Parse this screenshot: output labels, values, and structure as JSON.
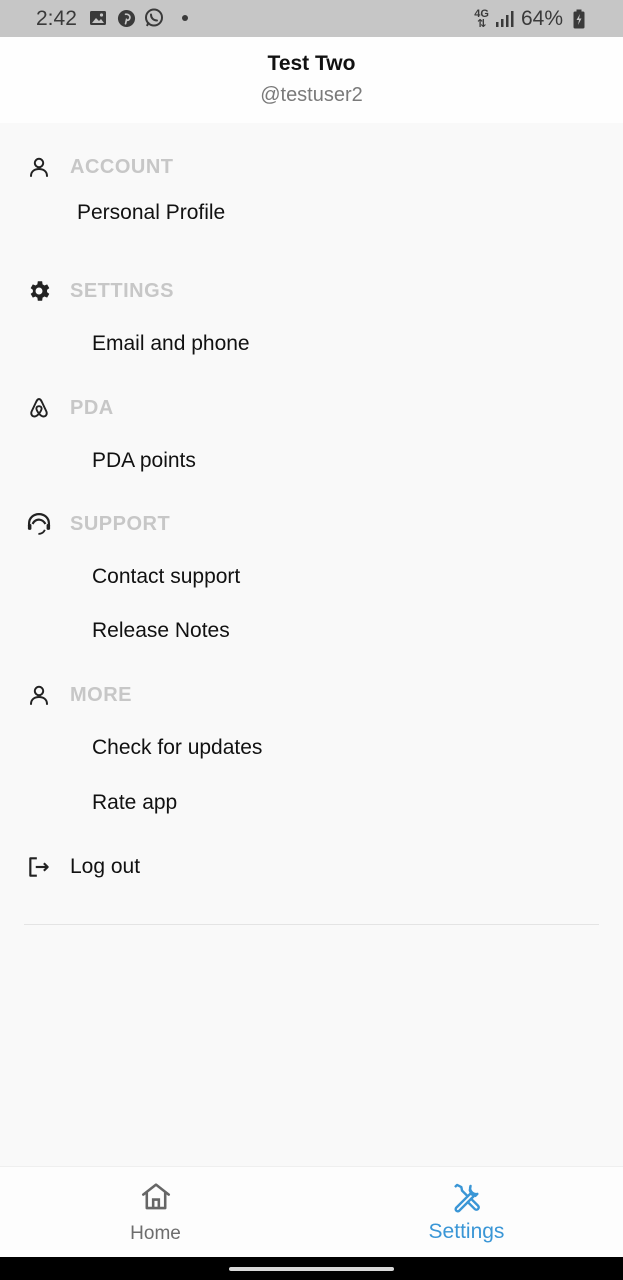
{
  "status_bar": {
    "time": "2:42",
    "network": "4G",
    "battery": "64%"
  },
  "profile": {
    "name": "Test Two",
    "handle": "@testuser2"
  },
  "sections": {
    "account": {
      "label": "ACCOUNT",
      "icon": "person-icon",
      "items": [
        "Personal Profile"
      ]
    },
    "settings": {
      "label": "SETTINGS",
      "icon": "gear-icon",
      "items": [
        "Email and phone"
      ]
    },
    "pda": {
      "label": "PDA",
      "icon": "airbnb-logo-icon",
      "items": [
        "PDA points"
      ]
    },
    "support": {
      "label": "SUPPORT",
      "icon": "support-agent-icon",
      "items": [
        "Contact support",
        "Release Notes"
      ]
    },
    "more": {
      "label": "MORE",
      "icon": "person-icon",
      "items": [
        "Check for updates",
        "Rate app"
      ]
    }
  },
  "logout": {
    "label": "Log out",
    "icon": "logout-icon"
  },
  "bottom_nav": {
    "home": {
      "label": "Home",
      "icon": "home-icon",
      "active": false
    },
    "settings": {
      "label": "Settings",
      "icon": "tools-icon",
      "active": true
    }
  },
  "colors": {
    "accent": "#3a96d6",
    "section_label": "#c7c7c7",
    "background": "#f9f9f9",
    "status_bar": "#c6c6c6"
  }
}
